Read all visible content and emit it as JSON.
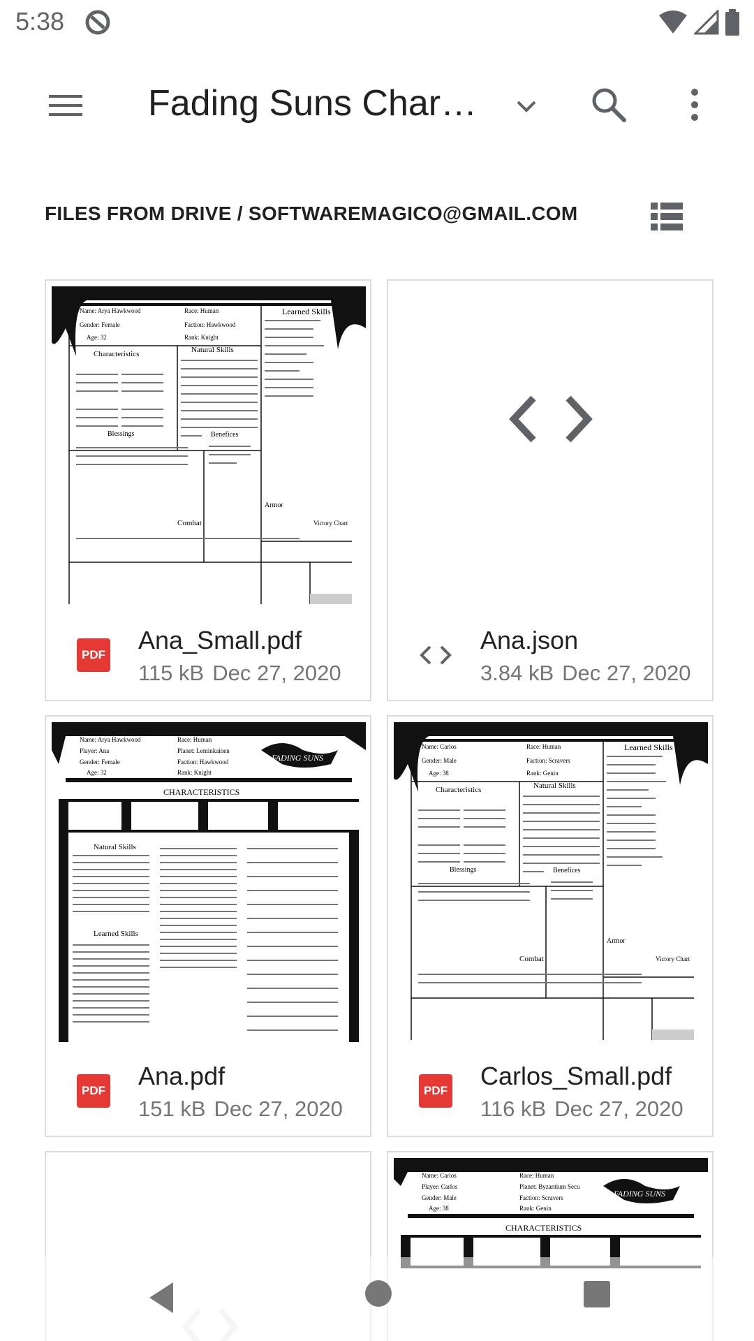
{
  "status_bar": {
    "time": "5:38"
  },
  "app_bar": {
    "title": "Fading Suns Chara…"
  },
  "section": {
    "header": "FILES FROM DRIVE / SOFTWAREMAGICO@GMAIL.COM"
  },
  "files": [
    {
      "name": "Ana_Small.pdf",
      "size": "115 kB",
      "date": "Dec 27, 2020",
      "type": "pdf"
    },
    {
      "name": "Ana.json",
      "size": "3.84 kB",
      "date": "Dec 27, 2020",
      "type": "json"
    },
    {
      "name": "Ana.pdf",
      "size": "151 kB",
      "date": "Dec 27, 2020",
      "type": "pdf"
    },
    {
      "name": "Carlos_Small.pdf",
      "size": "116 kB",
      "date": "Dec 27, 2020",
      "type": "pdf"
    }
  ],
  "thumb_text": {
    "ana_small": {
      "name": "Name: Arya Hawkwood",
      "race": "Race: Human",
      "gender": "Gender: Female",
      "faction": "Faction: Hawkwood",
      "age": "Age: 32",
      "rank": "Rank: Knight",
      "learned": "Learned Skills",
      "characteristics": "Characteristics",
      "natural": "Natural Skills",
      "blessings": "Blessings",
      "benefices": "Benefices",
      "armor": "Armor",
      "combat": "Combat",
      "victory": "Victory Chart"
    },
    "ana": {
      "name": "Name: Arya Hawkwood",
      "race": "Race: Human",
      "player": "Player: Ana",
      "planet": "Planet: Leminkainen",
      "gender": "Gender: Female",
      "faction": "Faction: Hawkwood",
      "age": "Age: 32",
      "rank": "Rank: Knight",
      "characteristics": "CHARACTERISTICS",
      "natural": "Natural Skills",
      "learned": "Learned Skills",
      "logo": "FADING SUNS"
    },
    "carlos_small": {
      "name": "Name: Carlos",
      "race": "Race: Human",
      "gender": "Gender: Male",
      "faction": "Faction: Scravers",
      "age": "Age: 38",
      "rank": "Rank: Genin",
      "learned": "Learned Skills",
      "characteristics": "Characteristics",
      "natural": "Natural Skills",
      "blessings": "Blessings",
      "benefices": "Benefices",
      "armor": "Armor",
      "combat": "Combat",
      "victory": "Victory Chart"
    },
    "carlos": {
      "name": "Name: Carlos",
      "race": "Race: Human",
      "player": "Player: Carlos",
      "planet": "Planet: Byzantium Secu",
      "gender": "Gender: Male",
      "faction": "Faction: Scravers",
      "age": "Age: 38",
      "rank": "Rank: Genin",
      "characteristics": "CHARACTERISTICS",
      "logo": "FADING SUNS"
    }
  },
  "colors": {
    "pdf_red": "#e53935",
    "icon_gray": "#5f6368",
    "border": "#dadce0"
  },
  "icons": {
    "menu": "hamburger-icon",
    "dropdown": "chevron-down-icon",
    "search": "search-icon",
    "more": "more-vert-icon",
    "list_view": "list-view-icon",
    "code": "code-icon"
  }
}
